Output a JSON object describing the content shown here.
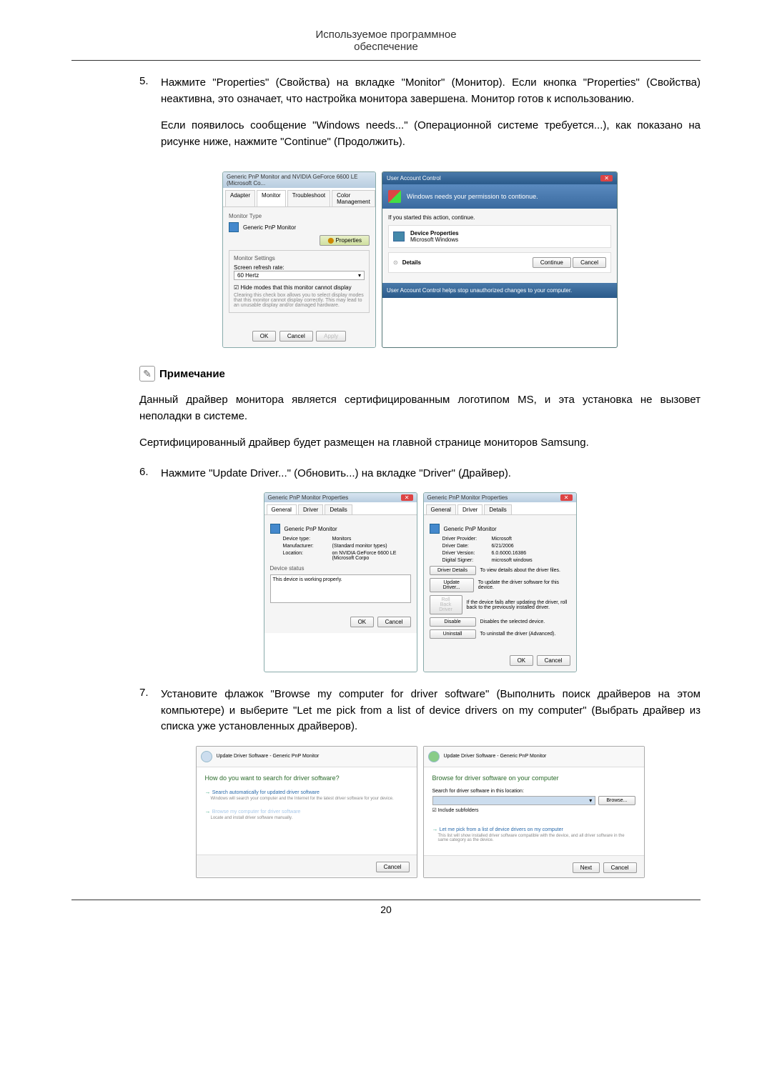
{
  "header": {
    "line1": "Используемое программное",
    "line2": "обеспечение"
  },
  "step5": {
    "num": "5.",
    "p1": "Нажмите \"Properties\" (Свойства) на вкладке \"Monitor\" (Монитор). Если кнопка \"Properties\" (Свойства) неактивна, это означает, что настройка монитора завершена. Монитор готов к использованию.",
    "p2": "Если появилось сообщение \"Windows needs...\" (Операционной системе требуется...), как показано на рисунке ниже, нажмите \"Continue\" (Продолжить)."
  },
  "dialog1": {
    "title": "Generic PnP Monitor and NVIDIA GeForce 6600 LE (Microsoft Co...",
    "tabs": {
      "adapter": "Adapter",
      "monitor": "Monitor",
      "troubleshoot": "Troubleshoot",
      "color": "Color Management"
    },
    "monitorType": "Monitor Type",
    "monitorName": "Generic PnP Monitor",
    "propertiesBtn": "Properties",
    "settings": "Monitor Settings",
    "refreshRate": "Screen refresh rate:",
    "hertz": "60 Hertz",
    "hideModes": "Hide modes that this monitor cannot display",
    "hideHelp": "Clearing this check box allows you to select display modes that this monitor cannot display correctly. This may lead to an unusable display and/or damaged hardware.",
    "ok": "OK",
    "cancel": "Cancel",
    "apply": "Apply"
  },
  "uac": {
    "title": "User Account Control",
    "banner": "Windows needs your permission to contionue.",
    "ifStarted": "If you started this action, continue.",
    "devProps": "Device Properties",
    "msWin": "Microsoft Windows",
    "details": "Details",
    "continue": "Continue",
    "cancel": "Cancel",
    "footer": "User Account Control helps stop unauthorized changes to your computer."
  },
  "note": {
    "title": "Примечание",
    "p1": "Данный драйвер монитора является сертифицированным логотипом MS, и эта установка не вызовет неполадки в системе.",
    "p2": "Сертифицированный драйвер будет размещен на главной странице мониторов Samsung."
  },
  "step6": {
    "num": "6.",
    "text": "Нажмите \"Update Driver...\" (Обновить...) на вкладке \"Driver\" (Драйвер)."
  },
  "props1": {
    "title": "Generic PnP Monitor Properties",
    "general": "General",
    "driver": "Driver",
    "details": "Details",
    "name": "Generic PnP Monitor",
    "devType": "Device type:",
    "devTypeVal": "Monitors",
    "mfr": "Manufacturer:",
    "mfrVal": "(Standard monitor types)",
    "loc": "Location:",
    "locVal": "on NVIDIA GeForce 6600 LE (Microsoft Corpo",
    "status": "Device status",
    "statusText": "This device is working properly.",
    "ok": "OK",
    "cancel": "Cancel"
  },
  "props2": {
    "title": "Generic PnP Monitor Properties",
    "name": "Generic PnP Monitor",
    "provider": "Driver Provider:",
    "providerVal": "Microsoft",
    "date": "Driver Date:",
    "dateVal": "6/21/2006",
    "version": "Driver Version:",
    "versionVal": "6.0.6000.16386",
    "signer": "Digital Signer:",
    "signerVal": "microsoft windows",
    "driverDetails": "Driver Details",
    "driverDetailsDesc": "To view details about the driver files.",
    "updateDriver": "Update Driver...",
    "updateDesc": "To update the driver software for this device.",
    "rollback": "Roll Back Driver",
    "rollbackDesc": "If the device fails after updating the driver, roll back to the previously installed driver.",
    "disable": "Disable",
    "disableDesc": "Disables the selected device.",
    "uninstall": "Uninstall",
    "uninstallDesc": "To uninstall the driver (Advanced).",
    "ok": "OK",
    "cancel": "Cancel"
  },
  "step7": {
    "num": "7.",
    "text": "Установите флажок \"Browse my computer for driver software\" (Выполнить поиск драйверов на этом компьютере) и выберите \"Let me pick from a list of device drivers on my computer\" (Выбрать драйвер из списка уже установленных драйверов)."
  },
  "wiz1": {
    "breadcrumb": "Update Driver Software - Generic PnP Monitor",
    "heading": "How do you want to search for driver software?",
    "opt1": "Search automatically for updated driver software",
    "opt1sub": "Windows will search your computer and the Internet for the latest driver software for your device.",
    "opt2": "Browse my computer for driver software",
    "opt2sub": "Locate and install driver software manually.",
    "cancel": "Cancel"
  },
  "wiz2": {
    "breadcrumb": "Update Driver Software - Generic PnP Monitor",
    "heading": "Browse for driver software on your computer",
    "searchLoc": "Search for driver software in this location:",
    "browse": "Browse...",
    "include": "Include subfolders",
    "pick": "Let me pick from a list of device drivers on my computer",
    "pickSub": "This list will show installed driver software compatible with the device, and all driver software in the same category as the device.",
    "next": "Next",
    "cancel": "Cancel"
  },
  "pageNum": "20"
}
